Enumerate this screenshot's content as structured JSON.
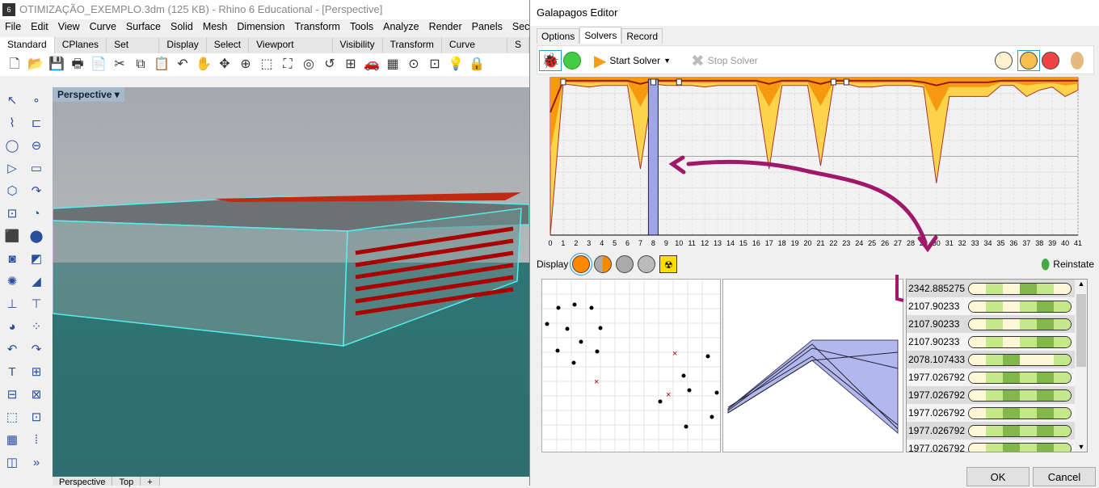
{
  "rhino": {
    "title": "OTIMIZAÇÃO_EXEMPLO.3dm (125 KB) - Rhino 6 Educational - [Perspective]",
    "menu": [
      "File",
      "Edit",
      "View",
      "Curve",
      "Surface",
      "Solid",
      "Mesh",
      "Dimension",
      "Transform",
      "Tools",
      "Analyze",
      "Render",
      "Panels",
      "Sectio"
    ],
    "toolbar_tabs": [
      "Standard",
      "CPlanes",
      "Set View",
      "Display",
      "Select",
      "Viewport Layout",
      "Visibility",
      "Transform",
      "Curve Tools",
      "S"
    ],
    "active_tab": "Standard",
    "tool_icons": [
      "new-icon",
      "open-icon",
      "save-icon",
      "print-icon",
      "import-icon",
      "cut-icon",
      "copy-icon",
      "paste-icon",
      "undo-icon",
      "pan-icon",
      "rotate-icon",
      "zoom-icon",
      "zoom-window-icon",
      "zoom-extents-icon",
      "zoom-selected-icon",
      "undo-view-icon",
      "viewports-icon",
      "car-icon",
      "grid-icon",
      "circle-icon",
      "snap-icon",
      "light-icon",
      "lock-icon"
    ],
    "viewport_label": "Perspective",
    "viewport_tabs": [
      "Perspective",
      "Top",
      "+"
    ],
    "more_label": "»"
  },
  "galapagos": {
    "title": "Galapagos Editor",
    "tabs": [
      "Options",
      "Solvers",
      "Record"
    ],
    "active_tab": "Solvers",
    "start_solver": "Start Solver",
    "stop_solver": "Stop Solver",
    "display_label": "Display",
    "reinstate": "Reinstate",
    "ok": "OK",
    "cancel": "Cancel",
    "colors": {
      "accent": "#ff8c00",
      "selection": "#9fa5e8",
      "annotation": "#a0186a",
      "genome_light": "#c4e88a",
      "genome_dark": "#82b84a"
    },
    "fitness_list": [
      "2342.885275",
      "2107.90233",
      "2107.90233",
      "2107.90233",
      "2078.107433",
      "1977.026792",
      "1977.026792",
      "1977.026792",
      "1977.026792",
      "1977.026792"
    ],
    "selected_generation": 8
  },
  "chart_data": {
    "type": "area",
    "xlabel": "",
    "ylabel": "",
    "x": [
      0,
      1,
      2,
      3,
      4,
      5,
      6,
      7,
      8,
      9,
      10,
      11,
      12,
      13,
      14,
      15,
      16,
      17,
      18,
      19,
      20,
      21,
      22,
      23,
      24,
      25,
      26,
      27,
      28,
      29,
      30,
      31,
      32,
      33,
      34,
      35,
      36,
      37,
      38,
      39,
      40,
      41
    ],
    "tick_labels": [
      "0",
      "1",
      "2",
      "3",
      "4",
      "5",
      "6",
      "7",
      "8",
      "9",
      "10",
      "11",
      "12",
      "13",
      "14",
      "15",
      "16",
      "17",
      "18",
      "19",
      "20",
      "21",
      "22",
      "23",
      "24",
      "25",
      "26",
      "27",
      "28",
      "29",
      "30",
      "31",
      "32",
      "33",
      "34",
      "35",
      "36",
      "37",
      "38",
      "39",
      "40",
      "41"
    ],
    "series": [
      {
        "role": "population-min",
        "values": [
          0,
          0.96,
          0.95,
          0.94,
          0.95,
          0.95,
          0.95,
          0.42,
          0.96,
          0.95,
          0.95,
          0.95,
          0.94,
          0.95,
          0.95,
          0.95,
          0.95,
          0.42,
          0.95,
          0.95,
          0.95,
          0.44,
          0.96,
          0.96,
          0.94,
          0.94,
          0.95,
          0.95,
          0.95,
          0.94,
          0.33,
          0.88,
          0.88,
          0.88,
          0.88,
          0.95,
          0.95,
          0.88,
          0.92,
          0.94,
          0.88,
          0.92
        ]
      },
      {
        "role": "population-mean",
        "values": [
          0.78,
          0.98,
          0.98,
          0.98,
          0.98,
          0.98,
          0.98,
          0.96,
          0.98,
          0.98,
          0.98,
          0.98,
          0.98,
          0.98,
          0.98,
          0.98,
          0.98,
          0.96,
          0.98,
          0.98,
          0.98,
          0.96,
          0.98,
          0.98,
          0.98,
          0.98,
          0.98,
          0.98,
          0.98,
          0.97,
          0.95,
          0.97,
          0.97,
          0.97,
          0.97,
          0.98,
          0.98,
          0.98,
          0.98,
          0.98,
          0.98,
          0.98
        ]
      }
    ],
    "ylim": [
      0,
      1
    ],
    "grid": true,
    "markers_at": [
      1,
      8,
      10,
      22,
      23
    ]
  }
}
